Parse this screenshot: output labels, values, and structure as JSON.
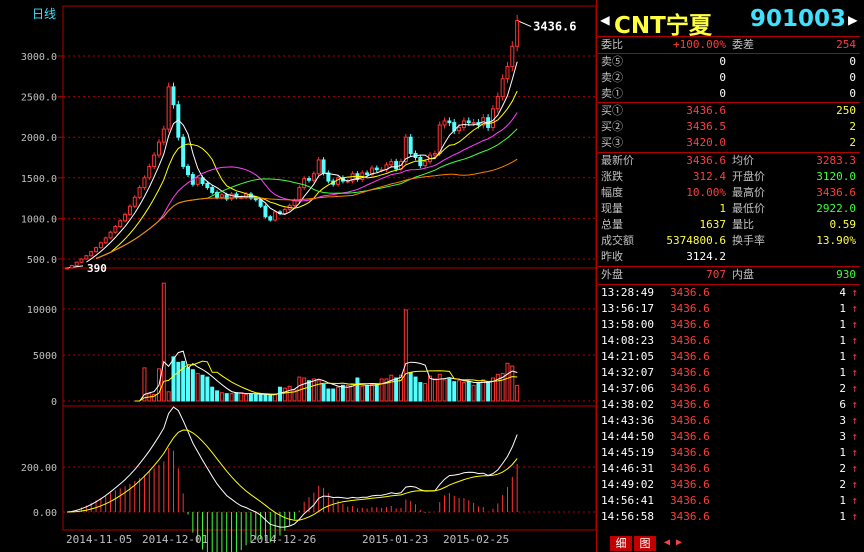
{
  "chart": {
    "period_label": "日线",
    "price_axis_ticks": [
      "3000.0",
      "2500.0",
      "2000.0",
      "1500.0",
      "1000.0",
      "500.0"
    ],
    "volume_axis_ticks": [
      "10000",
      "5000",
      "0"
    ],
    "macd_axis_ticks": [
      "200.00",
      "0.00"
    ],
    "x_dates": [
      "2014-11-05",
      "2014-12-01",
      "2014-12-26",
      "2015-01-23",
      "2015-02-25"
    ],
    "high_marker": "3436.6",
    "low_marker": "390",
    "colors": {
      "up": "#ff3232",
      "down": "#54ffff",
      "grid": "#b00000",
      "ma5": "#ffffff",
      "ma10": "#ffff00",
      "ma20": "#ff40ff",
      "ma30": "#40ff40",
      "ma60": "#ff8000"
    }
  },
  "quote": {
    "nav_left_icon": "arrow-left",
    "nav_right_icon": "arrow-right",
    "name": "CNT宁夏",
    "code": "901003",
    "weibi_label": "委比",
    "weibi_value": "+100.00%",
    "weicha_label": "委差",
    "weicha_value": "254",
    "sells": [
      {
        "label": "卖⑤",
        "price": "0",
        "vol": "0"
      },
      {
        "label": "卖②",
        "price": "0",
        "vol": "0"
      },
      {
        "label": "卖①",
        "price": "0",
        "vol": "0"
      }
    ],
    "buys": [
      {
        "label": "买①",
        "price": "3436.6",
        "vol": "250"
      },
      {
        "label": "买②",
        "price": "3436.5",
        "vol": "2"
      },
      {
        "label": "买③",
        "price": "3420.0",
        "vol": "2"
      }
    ],
    "stats": [
      {
        "l1": "最新价",
        "v1": "3436.6",
        "c1": "red",
        "l2": "均价",
        "v2": "3283.3",
        "c2": "red"
      },
      {
        "l1": "涨跌",
        "v1": "312.4",
        "c1": "red",
        "l2": "开盘价",
        "v2": "3120.0",
        "c2": "grn"
      },
      {
        "l1": "幅度",
        "v1": "10.00%",
        "c1": "red",
        "l2": "最高价",
        "v2": "3436.6",
        "c2": "red"
      },
      {
        "l1": "现量",
        "v1": "1",
        "c1": "yel",
        "l2": "最低价",
        "v2": "2922.0",
        "c2": "grn"
      },
      {
        "l1": "总量",
        "v1": "1637",
        "c1": "yel",
        "l2": "量比",
        "v2": "0.59",
        "c2": "yel"
      },
      {
        "l1": "成交额",
        "v1": "5374800.6",
        "c1": "yel",
        "l2": "换手率",
        "v2": "13.90%",
        "c2": "yel"
      }
    ],
    "prev_close_label": "昨收",
    "prev_close_value": "3124.2",
    "outer_label": "外盘",
    "outer_value": "707",
    "inner_label": "内盘",
    "inner_value": "930",
    "trades": [
      {
        "time": "13:28:49",
        "price": "3436.6",
        "vol": "4"
      },
      {
        "time": "13:56:17",
        "price": "3436.6",
        "vol": "1"
      },
      {
        "time": "13:58:00",
        "price": "3436.6",
        "vol": "1"
      },
      {
        "time": "14:08:23",
        "price": "3436.6",
        "vol": "1"
      },
      {
        "time": "14:21:05",
        "price": "3436.6",
        "vol": "1"
      },
      {
        "time": "14:32:07",
        "price": "3436.6",
        "vol": "1"
      },
      {
        "time": "14:37:06",
        "price": "3436.6",
        "vol": "2"
      },
      {
        "time": "14:38:02",
        "price": "3436.6",
        "vol": "6"
      },
      {
        "time": "14:43:36",
        "price": "3436.6",
        "vol": "3"
      },
      {
        "time": "14:44:50",
        "price": "3436.6",
        "vol": "3"
      },
      {
        "time": "14:45:19",
        "price": "3436.6",
        "vol": "1"
      },
      {
        "time": "14:46:31",
        "price": "3436.6",
        "vol": "2"
      },
      {
        "time": "14:49:02",
        "price": "3436.6",
        "vol": "2"
      },
      {
        "time": "14:56:41",
        "price": "3436.6",
        "vol": "1"
      },
      {
        "time": "14:56:58",
        "price": "3436.6",
        "vol": "1"
      }
    ],
    "up_arrow": "↑",
    "tabs": [
      "细",
      "图"
    ]
  },
  "chart_data": {
    "type": "candlestick",
    "x": [
      "2014-11-05",
      "2014-12-01",
      "2014-12-26",
      "2015-01-23",
      "2015-02-25"
    ],
    "close": [
      390,
      420,
      460,
      500,
      540,
      590,
      640,
      700,
      760,
      830,
      900,
      970,
      1050,
      1150,
      1260,
      1380,
      1500,
      1640,
      1780,
      1940,
      2100,
      2620,
      2400,
      2000,
      1640,
      1540,
      1420,
      1500,
      1430,
      1380,
      1320,
      1260,
      1290,
      1240,
      1300,
      1260,
      1260,
      1300,
      1250,
      1230,
      1150,
      1020,
      980,
      1080,
      1060,
      1110,
      1160,
      1220,
      1380,
      1490,
      1470,
      1550,
      1720,
      1560,
      1460,
      1420,
      1500,
      1460,
      1460,
      1550,
      1480,
      1560,
      1540,
      1620,
      1600,
      1600,
      1660,
      1700,
      1610,
      1700,
      2000,
      1800,
      1750,
      1650,
      1700,
      1780,
      1800,
      2150,
      2200,
      2180,
      2080,
      2120,
      2200,
      2180,
      2180,
      2150,
      2240,
      2120,
      2350,
      2500,
      2720,
      2870,
      3120,
      3436.6
    ],
    "volume": [
      0,
      0,
      0,
      0,
      0,
      0,
      0,
      0,
      0,
      0,
      0,
      0,
      0,
      0,
      0,
      0,
      3600,
      800,
      700,
      3500,
      12800,
      1000,
      4800,
      4200,
      4300,
      3600,
      3400,
      3000,
      2800,
      2600,
      1500,
      1100,
      900,
      800,
      800,
      900,
      900,
      700,
      700,
      700,
      800,
      700,
      600,
      700,
      1500,
      1400,
      1600,
      1200,
      2600,
      2500,
      2200,
      2400,
      2200,
      1800,
      1300,
      1300,
      1500,
      1700,
      1700,
      1900,
      2500,
      1600,
      1700,
      1800,
      1800,
      2400,
      2400,
      2800,
      2500,
      2800,
      9900,
      3100,
      2600,
      2000,
      1900,
      2700,
      2400,
      2900,
      2300,
      2400,
      2100,
      2200,
      2000,
      2100,
      1700,
      2000,
      2300,
      2100,
      2500,
      2900,
      3000,
      4100,
      3800,
      1700
    ],
    "ma_series": [
      "MA5",
      "MA10",
      "MA20",
      "MA30",
      "MA60"
    ],
    "macd_ticks": [
      200,
      0
    ],
    "price_ylim": [
      400,
      3500
    ],
    "volume_ylim": [
      0,
      13000
    ]
  }
}
